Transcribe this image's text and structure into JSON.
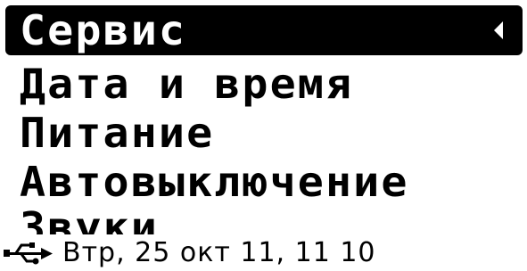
{
  "menu": {
    "title": "Сервис",
    "items": [
      {
        "label": "Сервис",
        "selected": true
      },
      {
        "label": "Дата и время",
        "selected": false
      },
      {
        "label": "Питание",
        "selected": false
      },
      {
        "label": "Автовыключение",
        "selected": false
      },
      {
        "label": "Звуки",
        "selected": false
      }
    ]
  },
  "status": {
    "usb_icon": "usb-icon",
    "text": "Втр, 25 окт 11, 11  10"
  },
  "colors": {
    "background": "#ffffff",
    "foreground": "#000000",
    "highlight": "#000000"
  }
}
